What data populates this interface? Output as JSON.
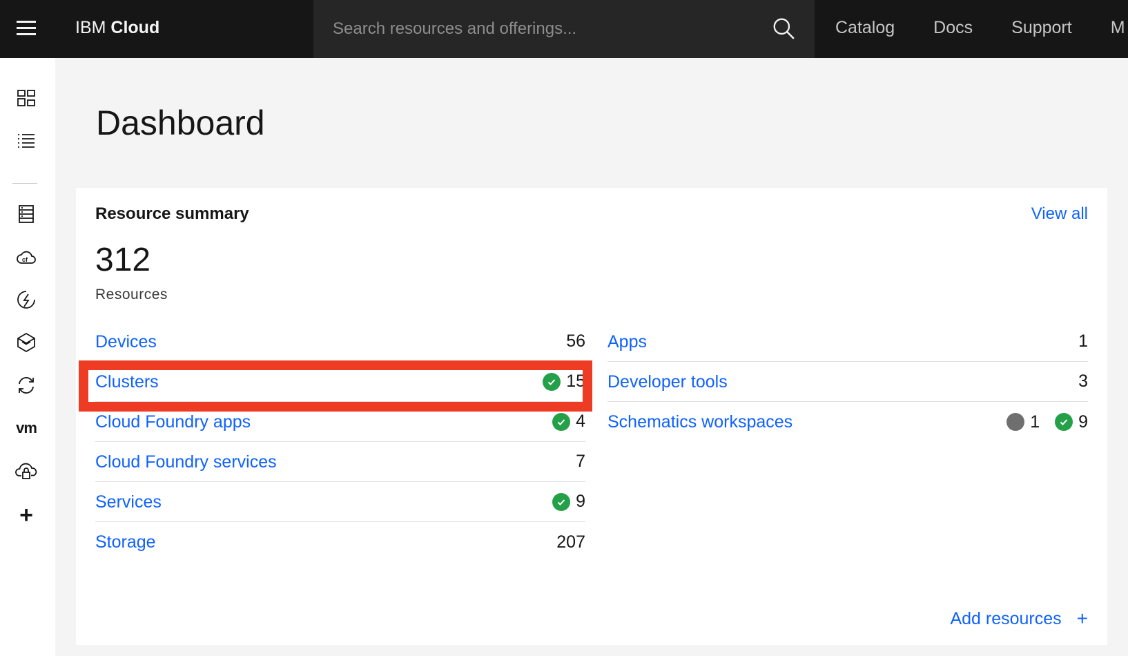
{
  "header": {
    "brand_prefix": "IBM",
    "brand_name": "Cloud",
    "search_placeholder": "Search resources and offerings...",
    "nav": [
      "Catalog",
      "Docs",
      "Support",
      "M"
    ]
  },
  "page": {
    "title": "Dashboard"
  },
  "resource_summary": {
    "title": "Resource summary",
    "view_all": "View all",
    "total": "312",
    "total_label": "Resources",
    "left": [
      {
        "label": "Devices",
        "count": "56"
      },
      {
        "label": "Clusters",
        "count": "15",
        "status": "ok"
      },
      {
        "label": "Cloud Foundry apps",
        "count": "4",
        "status": "ok"
      },
      {
        "label": "Cloud Foundry services",
        "count": "7"
      },
      {
        "label": "Services",
        "count": "9",
        "status": "ok"
      },
      {
        "label": "Storage",
        "count": "207"
      }
    ],
    "right": [
      {
        "label": "Apps",
        "count": "1"
      },
      {
        "label": "Developer tools",
        "count": "3"
      },
      {
        "label": "Schematics workspaces",
        "inactive_count": "1",
        "count": "9",
        "status": "ok"
      }
    ],
    "add_resources": "Add resources",
    "add_icon": "+"
  },
  "sidebar": {
    "vm_label": "vm",
    "plus_label": "+"
  },
  "colors": {
    "accent": "#0f62fe",
    "ok": "#24a148",
    "highlight": "#ee3b23",
    "header_bg": "#161616"
  }
}
